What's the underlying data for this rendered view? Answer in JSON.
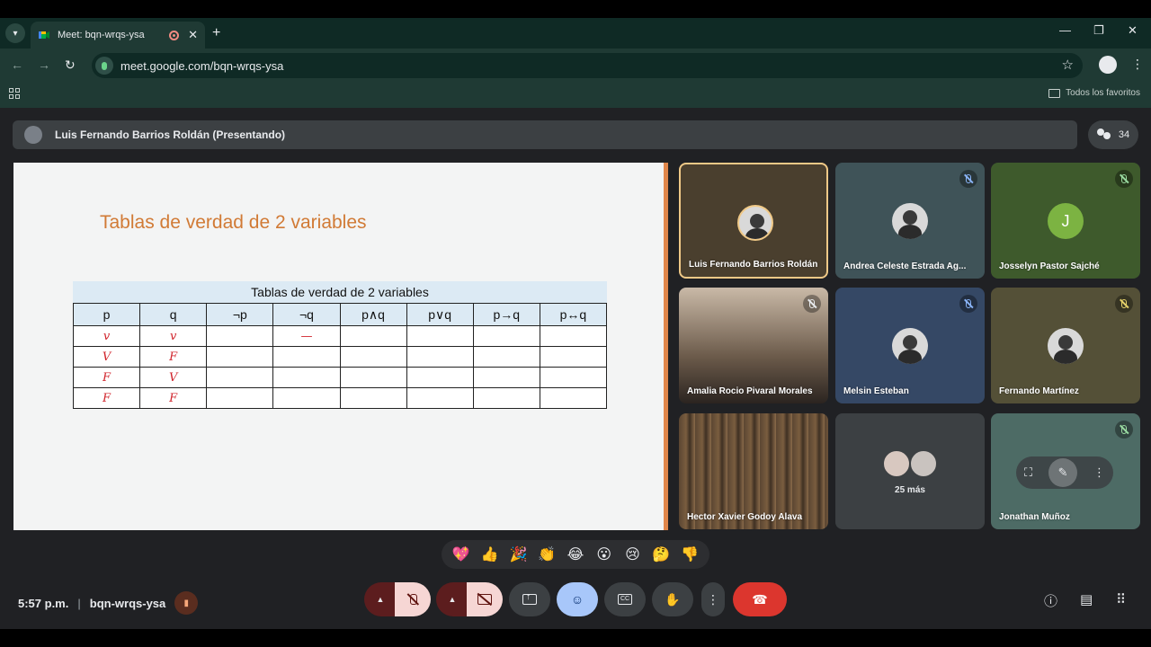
{
  "browser": {
    "tab_title": "Meet: bqn-wrqs-ysa",
    "url": "meet.google.com/bqn-wrqs-ysa",
    "bookmarks_folder": "Todos los favoritos"
  },
  "meeting": {
    "presenter_bar": "Luis Fernando Barrios Roldán (Presentando)",
    "participant_count": "34",
    "time": "5:57 p.m.",
    "code": "bqn-wrqs-ysa"
  },
  "slide": {
    "title": "Tablas de verdad de 2 variables",
    "table_caption": "Tablas de verdad de 2 variables",
    "headers": [
      "p",
      "q",
      "¬p",
      "¬q",
      "p∧q",
      "p∨q",
      "p→q",
      "p↔q"
    ],
    "rows": [
      [
        "v",
        "v",
        "",
        "—",
        "",
        "",
        "",
        ""
      ],
      [
        "V",
        "F",
        "",
        "",
        "",
        "",
        "",
        ""
      ],
      [
        "F",
        "V",
        "",
        "",
        "",
        "",
        "",
        ""
      ],
      [
        "F",
        "F",
        "",
        "",
        "",
        "",
        "",
        ""
      ]
    ]
  },
  "participants": [
    {
      "name": "Luis Fernando Barrios Roldán"
    },
    {
      "name": "Andrea Celeste Estrada Ag..."
    },
    {
      "name": "Josselyn Pastor Sajché",
      "initial": "J"
    },
    {
      "name": "Amalia Rocio Pivaral Morales"
    },
    {
      "name": "Melsin Esteban"
    },
    {
      "name": "Fernando Martínez"
    },
    {
      "name": "Hector Xavier Godoy Alava"
    },
    {
      "name": "25 más"
    },
    {
      "name": "Jonathan Muñoz"
    }
  ],
  "reactions": [
    "💖",
    "👍",
    "🎉",
    "👏",
    "😂",
    "😮",
    "😢",
    "🤔",
    "👎"
  ],
  "colors": {
    "accent_orange": "#d17a35",
    "end_call": "#dc362e",
    "active_control": "#a8c7fa",
    "active_speaker_border": "#f0c987"
  }
}
